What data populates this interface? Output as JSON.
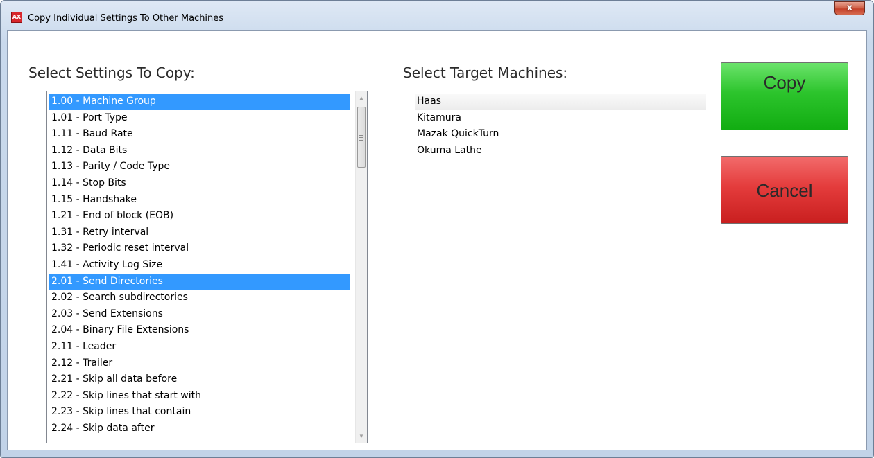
{
  "window": {
    "title": "Copy Individual Settings To Other Machines",
    "close_label": "x"
  },
  "settings": {
    "label": "Select Settings To Copy:",
    "items": [
      {
        "label": "1.00 - Machine Group",
        "selected": true
      },
      {
        "label": "1.01 - Port Type",
        "selected": false
      },
      {
        "label": "1.11 - Baud Rate",
        "selected": false
      },
      {
        "label": "1.12 - Data Bits",
        "selected": false
      },
      {
        "label": "1.13 - Parity / Code Type",
        "selected": false
      },
      {
        "label": "1.14 - Stop Bits",
        "selected": false
      },
      {
        "label": "1.15 - Handshake",
        "selected": false
      },
      {
        "label": "1.21 - End of block (EOB)",
        "selected": false
      },
      {
        "label": "1.31 - Retry interval",
        "selected": false
      },
      {
        "label": "1.32 - Periodic reset interval",
        "selected": false
      },
      {
        "label": "1.41 - Activity Log Size",
        "selected": false
      },
      {
        "label": "2.01 - Send Directories",
        "selected": true
      },
      {
        "label": "2.02 - Search subdirectories",
        "selected": false
      },
      {
        "label": "2.03 - Send Extensions",
        "selected": false
      },
      {
        "label": "2.04 - Binary File Extensions",
        "selected": false
      },
      {
        "label": "2.11 - Leader",
        "selected": false
      },
      {
        "label": "2.12 - Trailer",
        "selected": false
      },
      {
        "label": "2.21 - Skip all data before",
        "selected": false
      },
      {
        "label": "2.22 - Skip lines that start with",
        "selected": false
      },
      {
        "label": "2.23 - Skip lines that contain",
        "selected": false
      },
      {
        "label": "2.24 - Skip data after",
        "selected": false
      }
    ]
  },
  "targets": {
    "label": "Select Target Machines:",
    "items": [
      {
        "label": "Haas",
        "hover": true
      },
      {
        "label": "Kitamura",
        "hover": false
      },
      {
        "label": "Mazak QuickTurn",
        "hover": false
      },
      {
        "label": "Okuma Lathe",
        "hover": false
      }
    ]
  },
  "buttons": {
    "copy_label": "Copy",
    "cancel_label": "Cancel",
    "copy_color": "#2cc42c",
    "cancel_color": "#e43c3c"
  },
  "selection_color": "#3399ff"
}
